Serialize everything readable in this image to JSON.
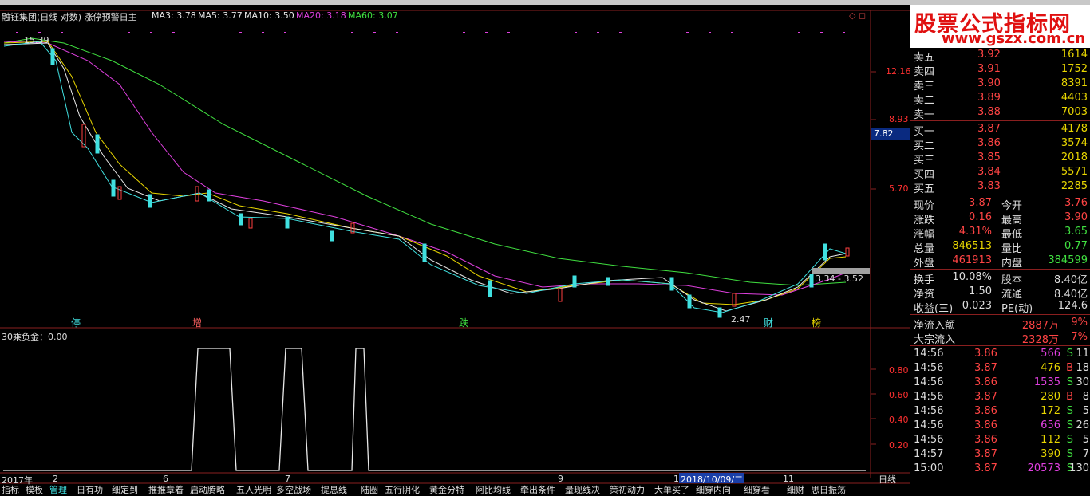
{
  "window": {
    "title": "融钰集团(日线 对数) 涨停预警日主",
    "ma": [
      {
        "label": "MA3: 3.78",
        "color": "#e8e8e8"
      },
      {
        "label": "MA5: 3.77",
        "color": "#e8e8e8"
      },
      {
        "label": "MA10: 3.50",
        "color": "#e8e8e8"
      },
      {
        "label": "MA20: 3.18",
        "color": "#e040e0"
      },
      {
        "label": "MA60: 3.07",
        "color": "#40e040"
      }
    ]
  },
  "chart": {
    "price_axis": [
      "12.16",
      "8.93",
      "5.70"
    ],
    "current_tag": "7.82",
    "high_label": "15.39",
    "low_label": "2.47",
    "range_label": "3.34 - 3.52",
    "markers": [
      {
        "text": "停",
        "color": "#40e0e0"
      },
      {
        "text": "增",
        "color": "#ff6060"
      },
      {
        "text": "跌",
        "color": "#40e040"
      },
      {
        "text": "财",
        "color": "#40e0e0"
      },
      {
        "text": "榜",
        "color": "#e8d600"
      }
    ],
    "sub_title": "30乘负金：0.00",
    "sub_axis": [
      "0.80",
      "0.60",
      "0.40",
      "0.20"
    ],
    "date_axis": [
      "2017年",
      "2",
      "6",
      "7",
      "9",
      "1",
      "11"
    ],
    "date_highlight": "2018/10/09/二"
  },
  "tabs": [
    "指标",
    "模板",
    "管理",
    "日有功",
    "细定到",
    "推推章着",
    "启动腾略",
    "五人光明",
    "多空战场",
    "提息线",
    "陆圈",
    "五行阴化",
    "黄金分特",
    "阿比均线",
    "牵出条件",
    "量现线决",
    "策初动力",
    "大单买了",
    "细穿内向",
    "细穿看",
    "细财",
    "思日振荡"
  ],
  "period_label": "日线",
  "logo": {
    "line1": "股票公式指标网",
    "line2": "www.gszx.com.cn"
  },
  "order_book": {
    "sell": [
      {
        "label": "卖五",
        "price": "3.92",
        "vol": "1614"
      },
      {
        "label": "卖四",
        "price": "3.91",
        "vol": "1752"
      },
      {
        "label": "卖三",
        "price": "3.90",
        "vol": "8391"
      },
      {
        "label": "卖二",
        "price": "3.89",
        "vol": "4403"
      },
      {
        "label": "卖一",
        "price": "3.88",
        "vol": "7003"
      }
    ],
    "buy": [
      {
        "label": "买一",
        "price": "3.87",
        "vol": "4178"
      },
      {
        "label": "买二",
        "price": "3.86",
        "vol": "3574"
      },
      {
        "label": "买三",
        "price": "3.85",
        "vol": "2018"
      },
      {
        "label": "买四",
        "price": "3.84",
        "vol": "5571"
      },
      {
        "label": "买五",
        "price": "3.83",
        "vol": "2285"
      }
    ]
  },
  "quote": [
    {
      "l1": "现价",
      "v1": "3.87",
      "c1": "#ff4444",
      "l2": "今开",
      "v2": "3.76",
      "c2": "#ff4444"
    },
    {
      "l1": "涨跌",
      "v1": "0.16",
      "c1": "#ff4444",
      "l2": "最高",
      "v2": "3.90",
      "c2": "#ff4444"
    },
    {
      "l1": "涨幅",
      "v1": "4.31%",
      "c1": "#ff4444",
      "l2": "最低",
      "v2": "3.65",
      "c2": "#40e040"
    },
    {
      "l1": "总量",
      "v1": "846513",
      "c1": "#e8d600",
      "l2": "量比",
      "v2": "0.77",
      "c2": "#40e040"
    },
    {
      "l1": "外盘",
      "v1": "461913",
      "c1": "#ff4444",
      "l2": "内盘",
      "v2": "384599",
      "c2": "#40e040"
    }
  ],
  "fundamentals": [
    {
      "l1": "换手",
      "v1": "10.08%",
      "l2": "股本",
      "v2": "8.40亿"
    },
    {
      "l1": "净资",
      "v1": "1.50",
      "l2": "流通",
      "v2": "8.40亿"
    },
    {
      "l1": "收益(三)",
      "v1": "0.023",
      "l2": "PE(动)",
      "v2": "124.6"
    }
  ],
  "flows": [
    {
      "label": "净流入额",
      "value": "2887万",
      "pct": "9%"
    },
    {
      "label": "大宗流入",
      "value": "2328万",
      "pct": "7%"
    }
  ],
  "ticks": [
    {
      "time": "14:56",
      "price": "3.86",
      "vol": "566",
      "vcolor": "#e040e0",
      "side": "S",
      "scolor": "#40e040",
      "count": "11"
    },
    {
      "time": "14:56",
      "price": "3.87",
      "vol": "476",
      "vcolor": "#e8d600",
      "side": "B",
      "scolor": "#ff4444",
      "count": "18"
    },
    {
      "time": "14:56",
      "price": "3.86",
      "vol": "1535",
      "vcolor": "#e040e0",
      "side": "S",
      "scolor": "#40e040",
      "count": "30"
    },
    {
      "time": "14:56",
      "price": "3.87",
      "vol": "280",
      "vcolor": "#e8d600",
      "side": "B",
      "scolor": "#ff4444",
      "count": "8"
    },
    {
      "time": "14:56",
      "price": "3.86",
      "vol": "172",
      "vcolor": "#e8d600",
      "side": "S",
      "scolor": "#40e040",
      "count": "5"
    },
    {
      "time": "14:56",
      "price": "3.86",
      "vol": "656",
      "vcolor": "#e040e0",
      "side": "S",
      "scolor": "#40e040",
      "count": "26"
    },
    {
      "time": "14:56",
      "price": "3.86",
      "vol": "112",
      "vcolor": "#e8d600",
      "side": "S",
      "scolor": "#40e040",
      "count": "5"
    },
    {
      "time": "14:57",
      "price": "3.87",
      "vol": "390",
      "vcolor": "#e8d600",
      "side": "S",
      "scolor": "#40e040",
      "count": "7"
    },
    {
      "time": "15:00",
      "price": "3.87",
      "vol": "20573",
      "vcolor": "#e040e0",
      "side": "S",
      "scolor": "#40e040",
      "count": "130"
    }
  ]
}
